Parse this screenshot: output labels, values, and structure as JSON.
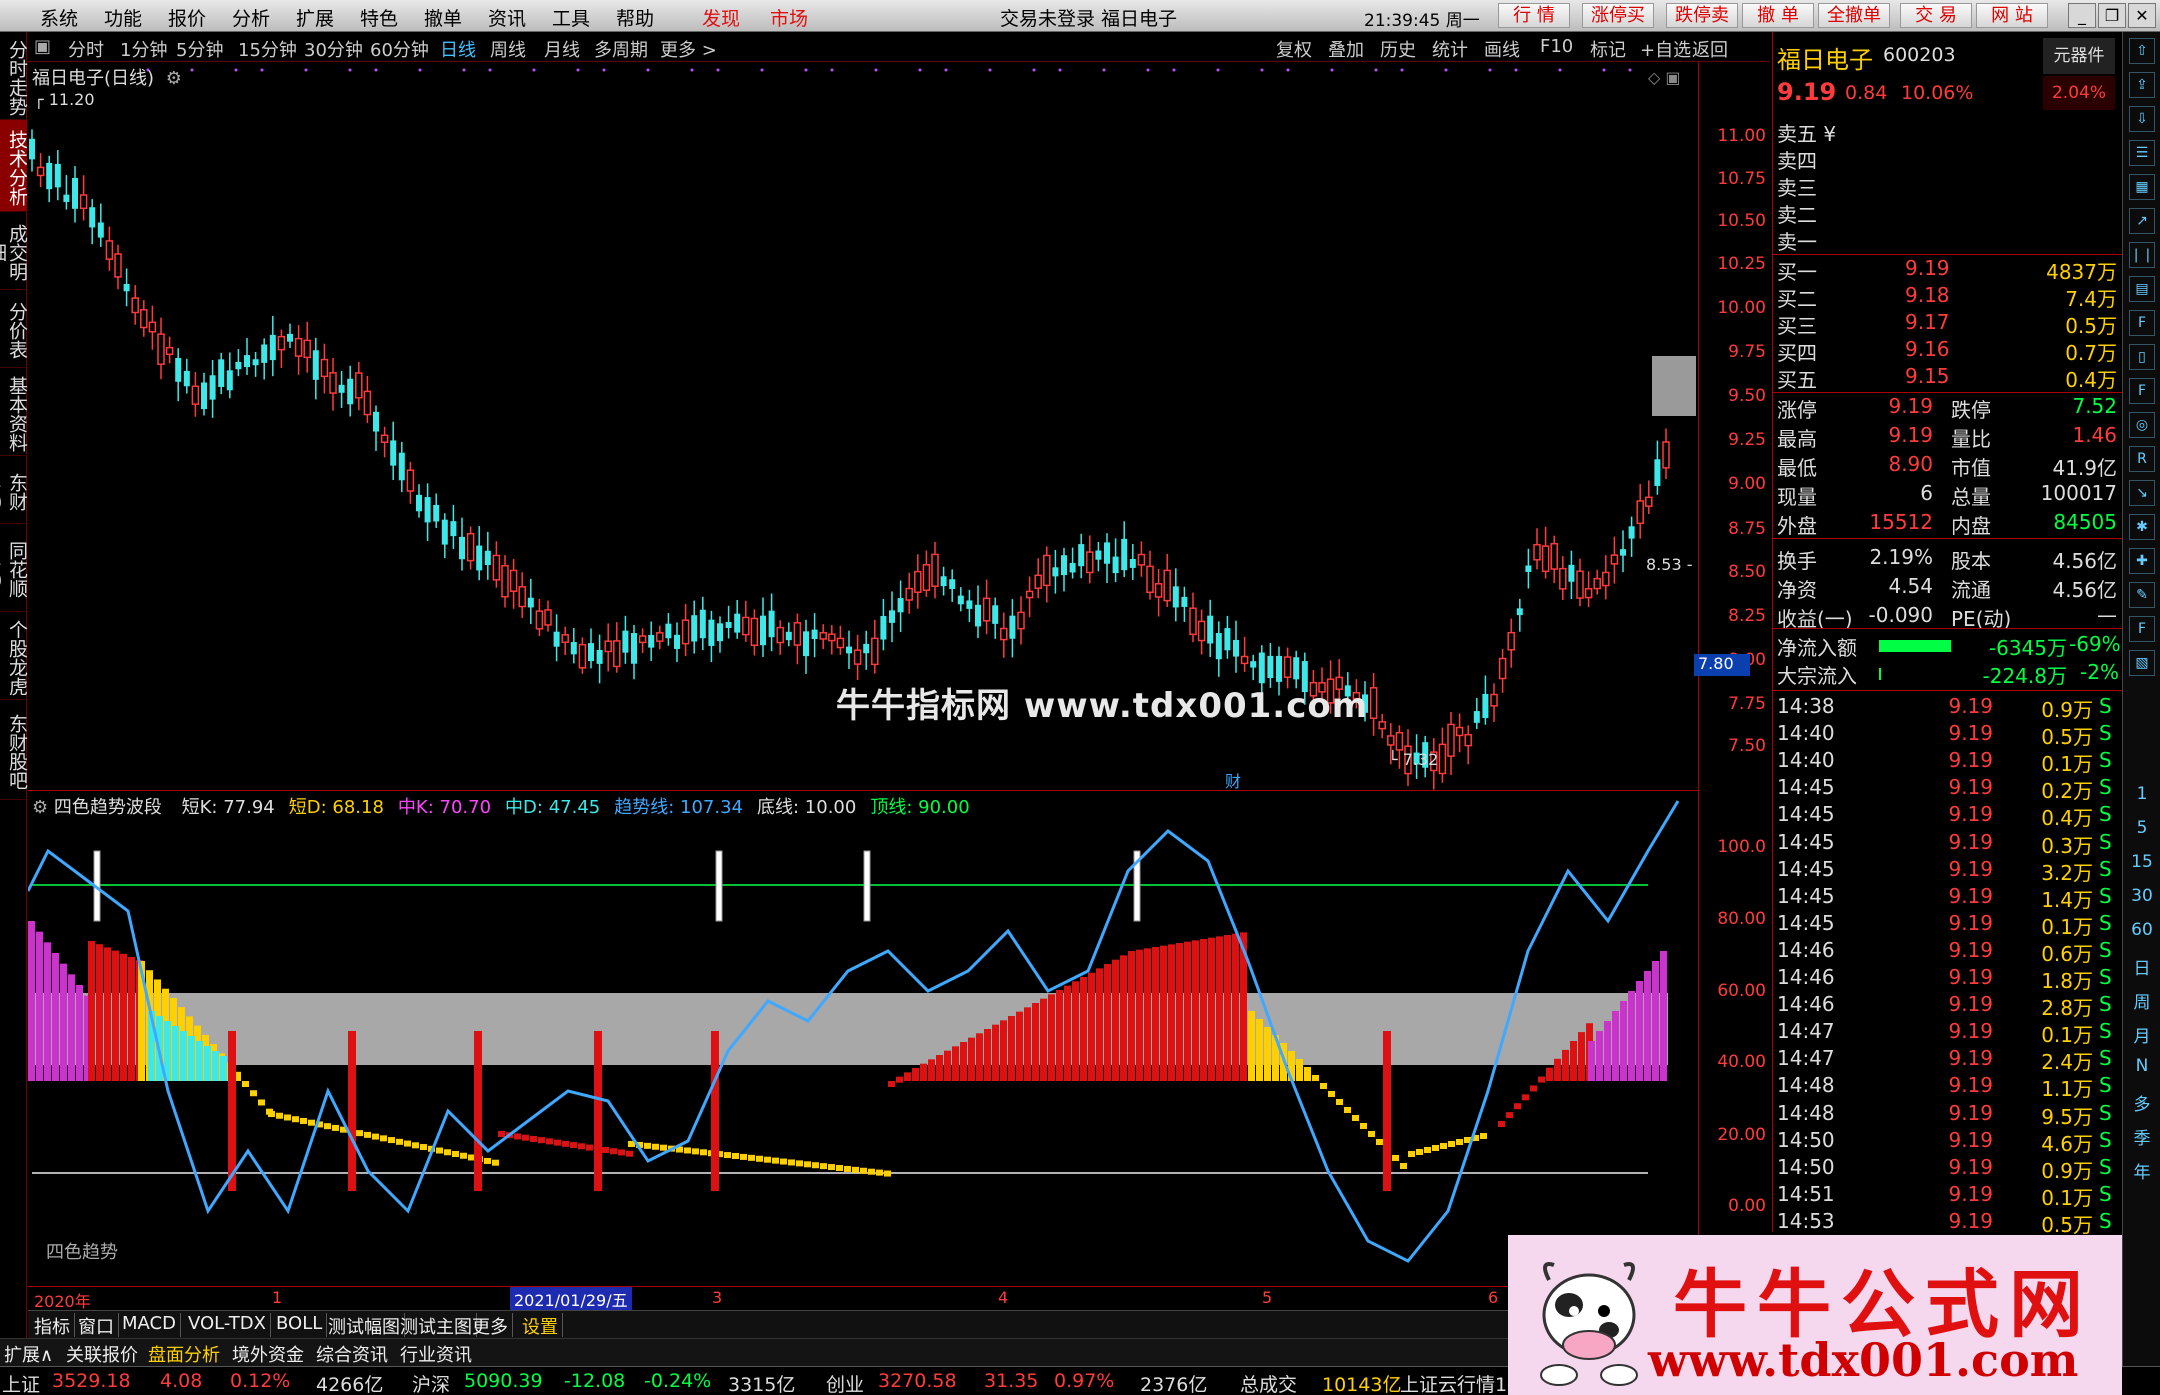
{
  "menu": {
    "items": [
      "系统",
      "功能",
      "报价",
      "分析",
      "扩展",
      "特色",
      "撤单",
      "资讯",
      "工具",
      "帮助"
    ],
    "highlight_items": [
      "发现",
      "市场"
    ],
    "window_info": "交易未登录  福日电子",
    "clock": "21:39:45 周一",
    "right_buttons": [
      "行 情",
      "涨停买",
      "跌停卖",
      "撤 单",
      "全撤单",
      "交 易",
      "网 站"
    ]
  },
  "side_tabs": [
    "分时走势",
    "技术分析",
    "成交明细",
    "分价表",
    "基本资料",
    "东财10",
    "同花顺10",
    "个股龙虎",
    "东财股吧"
  ],
  "period_bar": {
    "periods": [
      "分时",
      "1分钟",
      "5分钟",
      "15分钟",
      "30分钟",
      "60分钟",
      "日线",
      "周线",
      "月线",
      "多周期",
      "更多 >"
    ],
    "active": "日线",
    "tools": [
      "复权",
      "叠加",
      "历史",
      "统计",
      "画线",
      "F10",
      "标记",
      "+自选",
      "返回"
    ]
  },
  "main_chart": {
    "title": "福日电子(日线)",
    "high_marker": "11.20",
    "low_marker": "7.32",
    "last_marker": "8.53",
    "price_tag": "7.80",
    "event_tag": "财",
    "price_axis": [
      "11.00",
      "10.75",
      "10.50",
      "10.25",
      "10.00",
      "9.75",
      "9.50",
      "9.25",
      "9.00",
      "8.75",
      "8.50",
      "8.25",
      "8.00",
      "7.75",
      "7.50"
    ]
  },
  "watermark": "牛牛指标网 www.tdx001.com",
  "indicator": {
    "name": "四色趋势波段",
    "values": [
      {
        "label": "短K: 77.94",
        "color": "#dddddd"
      },
      {
        "label": "短D: 68.18",
        "color": "#ffd000"
      },
      {
        "label": "中K: 70.70",
        "color": "#ff44ff"
      },
      {
        "label": "中D: 47.45",
        "color": "#3fe8e8"
      },
      {
        "label": "趋势线: 107.34",
        "color": "#3fa8ff"
      },
      {
        "label": "底线: 10.00",
        "color": "#dddddd"
      },
      {
        "label": "顶线: 90.00",
        "color": "#00ff44"
      }
    ],
    "axis": [
      "100.0",
      "80.00",
      "60.00",
      "40.00",
      "20.00",
      "0.00"
    ],
    "caption": "四色趋势"
  },
  "date_axis": {
    "year": "2020年",
    "selected_date": "2021/01/29/五",
    "months": [
      "1",
      "3",
      "4",
      "5",
      "6"
    ]
  },
  "indicator_tabs": [
    "指标",
    "窗口",
    "MACD",
    "VOL-TDX",
    "BOLL",
    "测试幅图",
    "测试主图",
    "更多",
    "设置"
  ],
  "bottom_tabs": [
    "扩展∧",
    "关联报价",
    "盘面分析",
    "境外资金",
    "综合资讯",
    "行业资讯"
  ],
  "status_bar": {
    "sh_label": "上证",
    "sh_value": "3529.18",
    "sh_change": "4.08",
    "sh_pct": "0.12%",
    "sh_amount": "4266亿",
    "sz_label": "沪深",
    "sz_value": "5090.39",
    "sz_change": "-12.08",
    "sz_pct": "-0.24%",
    "sz_amount": "3315亿",
    "cy_label": "创业",
    "cy_value": "3270.58",
    "cy_change": "31.35",
    "cy_pct": "0.97%",
    "cy_amount": "2376亿",
    "total_label": "总成交",
    "total_value": "10143亿",
    "ticker": "上证云行情1"
  },
  "quote": {
    "name": "福日电子",
    "code": "600203",
    "badge": "元器件",
    "price": "9.19",
    "change": "0.84",
    "pct": "10.06%",
    "badge_pct": "2.04%",
    "sells": [
      "卖五 ¥",
      "卖四",
      "卖三",
      "卖二",
      "卖一"
    ],
    "buys": [
      {
        "label": "买一",
        "price": "9.19",
        "vol": "4837万"
      },
      {
        "label": "买二",
        "price": "9.18",
        "vol": "7.4万"
      },
      {
        "label": "买三",
        "price": "9.17",
        "vol": "0.5万"
      },
      {
        "label": "买四",
        "price": "9.16",
        "vol": "0.7万"
      },
      {
        "label": "买五",
        "price": "9.15",
        "vol": "0.4万"
      }
    ],
    "stats": [
      {
        "l1": "涨停",
        "v1": "9.19",
        "c1": "red",
        "l2": "跌停",
        "v2": "7.52",
        "c2": "green"
      },
      {
        "l1": "最高",
        "v1": "9.19",
        "c1": "red",
        "l2": "量比",
        "v2": "1.46",
        "c2": "red"
      },
      {
        "l1": "最低",
        "v1": "8.90",
        "c1": "red",
        "l2": "市值",
        "v2": "41.9亿",
        "c2": "white"
      },
      {
        "l1": "现量",
        "v1": "6",
        "c1": "white",
        "l2": "总量",
        "v2": "100017",
        "c2": "white"
      },
      {
        "l1": "外盘",
        "v1": "15512",
        "c1": "red",
        "l2": "内盘",
        "v2": "84505",
        "c2": "green"
      },
      {
        "l1": "换手",
        "v1": "2.19%",
        "c1": "white",
        "l2": "股本",
        "v2": "4.56亿",
        "c2": "white"
      },
      {
        "l1": "净资",
        "v1": "4.54",
        "c1": "white",
        "l2": "流通",
        "v2": "4.56亿",
        "c2": "white"
      },
      {
        "l1": "收益(一)",
        "v1": "-0.090",
        "c1": "white",
        "l2": "PE(动)",
        "v2": "—",
        "c2": "white"
      }
    ],
    "flows": [
      {
        "label": "净流入额",
        "value": "-6345万",
        "pct": "-69%",
        "bar": 0.9
      },
      {
        "label": "大宗流入",
        "value": "-224.8万",
        "pct": "-2%",
        "bar": 0.02
      }
    ],
    "ticks": [
      {
        "t": "14:38",
        "p": "9.19",
        "v": "0.9万",
        "s": "S"
      },
      {
        "t": "14:40",
        "p": "9.19",
        "v": "0.5万",
        "s": "S"
      },
      {
        "t": "14:40",
        "p": "9.19",
        "v": "0.1万",
        "s": "S"
      },
      {
        "t": "14:45",
        "p": "9.19",
        "v": "0.2万",
        "s": "S"
      },
      {
        "t": "14:45",
        "p": "9.19",
        "v": "0.4万",
        "s": "S"
      },
      {
        "t": "14:45",
        "p": "9.19",
        "v": "0.3万",
        "s": "S"
      },
      {
        "t": "14:45",
        "p": "9.19",
        "v": "3.2万",
        "s": "S"
      },
      {
        "t": "14:45",
        "p": "9.19",
        "v": "1.4万",
        "s": "S"
      },
      {
        "t": "14:45",
        "p": "9.19",
        "v": "0.1万",
        "s": "S"
      },
      {
        "t": "14:46",
        "p": "9.19",
        "v": "0.6万",
        "s": "S"
      },
      {
        "t": "14:46",
        "p": "9.19",
        "v": "1.8万",
        "s": "S"
      },
      {
        "t": "14:46",
        "p": "9.19",
        "v": "2.8万",
        "s": "S"
      },
      {
        "t": "14:47",
        "p": "9.19",
        "v": "0.1万",
        "s": "S"
      },
      {
        "t": "14:47",
        "p": "9.19",
        "v": "2.4万",
        "s": "S"
      },
      {
        "t": "14:48",
        "p": "9.19",
        "v": "1.1万",
        "s": "S"
      },
      {
        "t": "14:48",
        "p": "9.19",
        "v": "9.5万",
        "s": "S"
      },
      {
        "t": "14:50",
        "p": "9.19",
        "v": "4.6万",
        "s": "S"
      },
      {
        "t": "14:50",
        "p": "9.19",
        "v": "0.9万",
        "s": "S"
      },
      {
        "t": "14:51",
        "p": "9.19",
        "v": "0.1万",
        "s": "S"
      },
      {
        "t": "14:53",
        "p": "9.19",
        "v": "0.5万",
        "s": "S"
      }
    ]
  },
  "right_toolbar": [
    "up-arrow-icon",
    "nav-icon",
    "down-arrow-icon",
    "list-icon",
    "grid-icon",
    "line-chart-icon",
    "candle-icon",
    "page-icon",
    "f10-icon",
    "doc-icon",
    "f2-icon",
    "circle-icon",
    "rsi-icon",
    "arrow-icon",
    "bug-icon",
    "cross-icon",
    "pen-icon",
    "f5-icon",
    "layer-icon"
  ],
  "right_periods": [
    "1",
    "5",
    "15",
    "30",
    "60",
    "日",
    "周",
    "月",
    "N",
    "多",
    "季",
    "年"
  ],
  "banner": {
    "title": "牛牛公式网",
    "url": "www.tdx001.com"
  }
}
